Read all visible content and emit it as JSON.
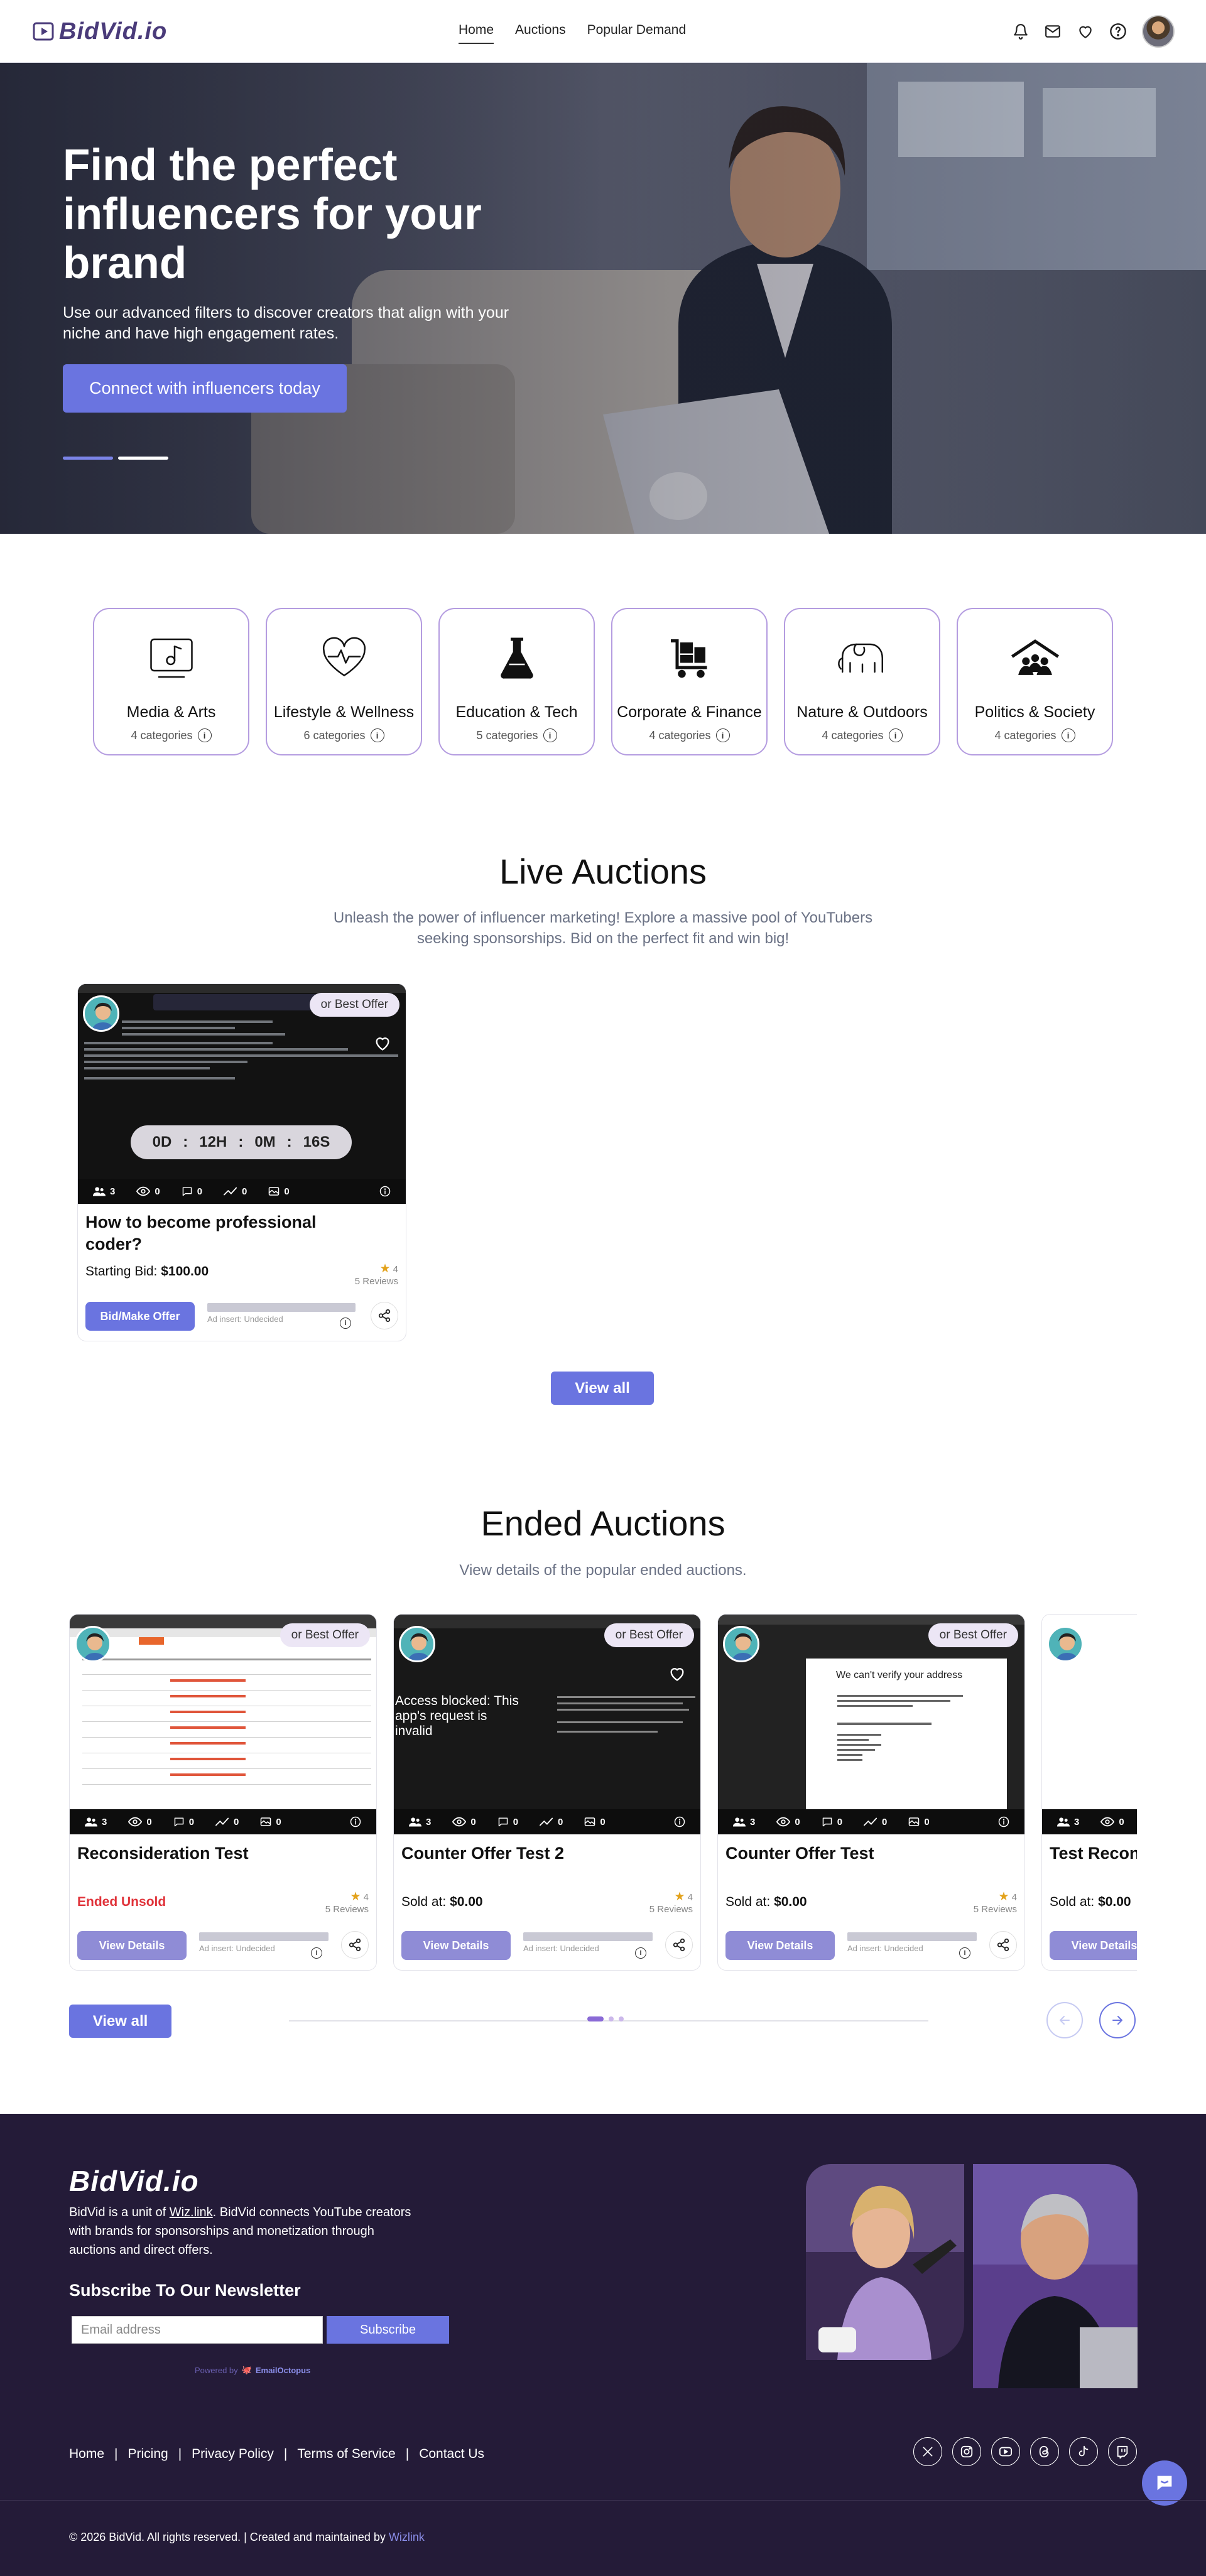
{
  "brand": {
    "logo_text": "BidVid.io",
    "accent": "#6a74e0",
    "footer_bg": "#241b38"
  },
  "nav": {
    "items": [
      "Home",
      "Auctions",
      "Popular Demand"
    ],
    "active": "Home"
  },
  "header_icons": [
    "bell-icon",
    "mail-icon",
    "heart-icon",
    "help-icon"
  ],
  "hero": {
    "title": "Find the perfect influencers for your brand",
    "subtitle": "Use our advanced filters to discover creators that align with your niche and have high engagement rates.",
    "cta": "Connect with influencers today"
  },
  "categories": [
    {
      "name": "Media & Arts",
      "count": "4 categories",
      "icon": "music-note-icon"
    },
    {
      "name": "Lifestyle & Wellness",
      "count": "6 categories",
      "icon": "heartbeat-icon"
    },
    {
      "name": "Education & Tech",
      "count": "5 categories",
      "icon": "flask-icon"
    },
    {
      "name": "Corporate & Finance",
      "count": "4 categories",
      "icon": "cart-boxes-icon"
    },
    {
      "name": "Nature & Outdoors",
      "count": "4 categories",
      "icon": "elephant-icon"
    },
    {
      "name": "Politics & Society",
      "count": "4 categories",
      "icon": "community-icon"
    }
  ],
  "live": {
    "title": "Live Auctions",
    "subtitle": "Unleash the power of influencer marketing! Explore a massive pool of YouTubers seeking sponsorships. Bid on the perfect fit and win big!",
    "card": {
      "badge": "or Best Offer",
      "timer": {
        "d": "0D",
        "h": "12H",
        "m": "0M",
        "s": "16S"
      },
      "stats": {
        "subscribers": "3",
        "views": "0",
        "comments": "0",
        "trend": "0",
        "media": "0"
      },
      "title": "How to become professional coder?",
      "price_label": "Starting Bid:",
      "price": "$100.00",
      "rating": "4",
      "reviews": "5 Reviews",
      "button": "Bid/Make Offer",
      "ad_insert": "Ad insert: Undecided"
    },
    "view_all": "View all"
  },
  "ended": {
    "title": "Ended Auctions",
    "subtitle": "View details of the popular ended auctions.",
    "cards": [
      {
        "badge": "or Best Offer",
        "title": "Reconsideration Test",
        "status_a": "Ended",
        "status_b": "Unsold",
        "rating": "4",
        "reviews": "5 Reviews",
        "button": "View Details",
        "ad_insert": "Ad insert: Undecided",
        "stats": {
          "subscribers": "3",
          "views": "0",
          "comments": "0",
          "trend": "0",
          "media": "0"
        }
      },
      {
        "badge": "or Best Offer",
        "title": "Counter Offer Test 2",
        "price_label": "Sold at:",
        "price": "$0.00",
        "rating": "4",
        "reviews": "5 Reviews",
        "button": "View Details",
        "ad_insert": "Ad insert: Undecided",
        "thumb_text": "Access blocked: This app's request is invalid",
        "stats": {
          "subscribers": "3",
          "views": "0",
          "comments": "0",
          "trend": "0",
          "media": "0"
        }
      },
      {
        "badge": "or Best Offer",
        "title": "Counter Offer Test",
        "price_label": "Sold at:",
        "price": "$0.00",
        "rating": "4",
        "reviews": "5 Reviews",
        "button": "View Details",
        "ad_insert": "Ad insert: Undecided",
        "thumb_text": "We can't verify your address",
        "stats": {
          "subscribers": "3",
          "views": "0",
          "comments": "0",
          "trend": "0",
          "media": "0"
        }
      },
      {
        "title": "Test Recon",
        "price_label": "Sold at:",
        "price": "$0.00",
        "button": "View Details",
        "stats": {
          "subscribers": "3",
          "views": "0"
        }
      }
    ],
    "view_all": "View all"
  },
  "footer": {
    "logo_text": "BidVid.io",
    "desc_prefix": "BidVid is a unit of ",
    "desc_link": "Wiz.link",
    "desc_suffix": ". BidVid connects YouTube creators with brands for sponsorships and monetization through auctions and direct offers.",
    "newsletter_title": "Subscribe To Our Newsletter",
    "email_placeholder": "Email address",
    "subscribe": "Subscribe",
    "powered_prefix": "Powered by",
    "powered_brand": "EmailOctopus",
    "links": [
      "Home",
      "Pricing",
      "Privacy Policy",
      "Terms of Service",
      "Contact Us"
    ],
    "social_icons": [
      "x-icon",
      "instagram-icon",
      "youtube-icon",
      "threads-icon",
      "tiktok-icon",
      "twitch-icon"
    ],
    "copyright_prefix": "© 2026 BidVid. All rights reserved. | Created and maintained by ",
    "copyright_link": "Wizlink"
  }
}
